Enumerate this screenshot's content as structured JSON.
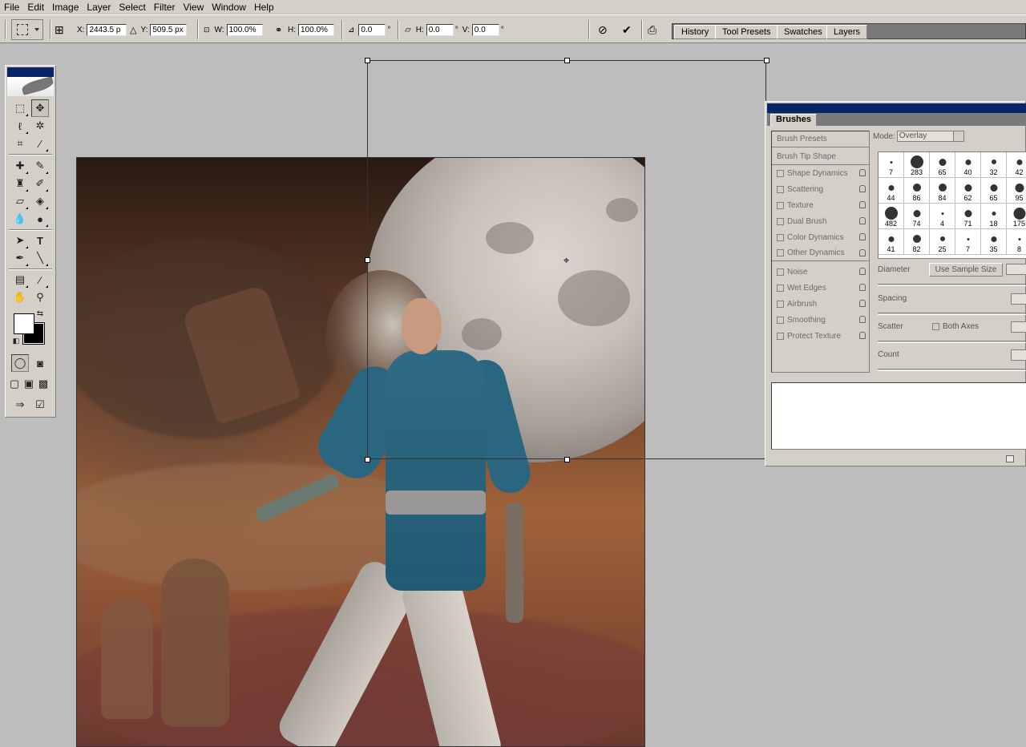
{
  "menu": [
    "File",
    "Edit",
    "Image",
    "Layer",
    "Select",
    "Filter",
    "View",
    "Window",
    "Help"
  ],
  "options": {
    "x_label": "X:",
    "x_value": "2443.5 p",
    "y_label": "Y:",
    "y_value": "509.5 px",
    "w_label": "W:",
    "w_value": "100.0%",
    "h_label": "H:",
    "h_value": "100.0%",
    "angle_value": "0.0",
    "deg": "°",
    "hskew_label": "H:",
    "hskew_value": "0.0",
    "vskew_label": "V:",
    "vskew_value": "0.0"
  },
  "palette_well": {
    "tabs": [
      "History",
      "Tool Presets",
      "Swatches",
      "Layers"
    ]
  },
  "brushes": {
    "tab": "Brushes",
    "mode_label": "Mode:",
    "mode_value": "Overlay",
    "list": [
      {
        "label": "Brush Presets",
        "checkbox": false,
        "lock": false,
        "header": true
      },
      {
        "label": "Brush Tip Shape",
        "checkbox": false,
        "lock": false,
        "header": true
      },
      {
        "label": "Shape Dynamics",
        "checkbox": true,
        "lock": true
      },
      {
        "label": "Scattering",
        "checkbox": true,
        "lock": true
      },
      {
        "label": "Texture",
        "checkbox": true,
        "lock": true
      },
      {
        "label": "Dual Brush",
        "checkbox": true,
        "lock": true
      },
      {
        "label": "Color Dynamics",
        "checkbox": true,
        "lock": true
      },
      {
        "label": "Other Dynamics",
        "checkbox": true,
        "lock": true
      },
      {
        "label": "Noise",
        "checkbox": true,
        "lock": true
      },
      {
        "label": "Wet Edges",
        "checkbox": true,
        "lock": true
      },
      {
        "label": "Airbrush",
        "checkbox": true,
        "lock": true
      },
      {
        "label": "Smoothing",
        "checkbox": true,
        "lock": true
      },
      {
        "label": "Protect Texture",
        "checkbox": true,
        "lock": true
      }
    ],
    "sizes": [
      "7",
      "283",
      "65",
      "40",
      "32",
      "42",
      "44",
      "86",
      "84",
      "62",
      "65",
      "95",
      "482",
      "74",
      "4",
      "71",
      "18",
      "175",
      "41",
      "82",
      "25",
      "7",
      "35",
      "8"
    ],
    "diameter_label": "Diameter",
    "use_sample_size": "Use Sample Size",
    "spacing_label": "Spacing",
    "scatter_label": "Scatter",
    "both_axes_label": "Both Axes",
    "count_label": "Count"
  }
}
